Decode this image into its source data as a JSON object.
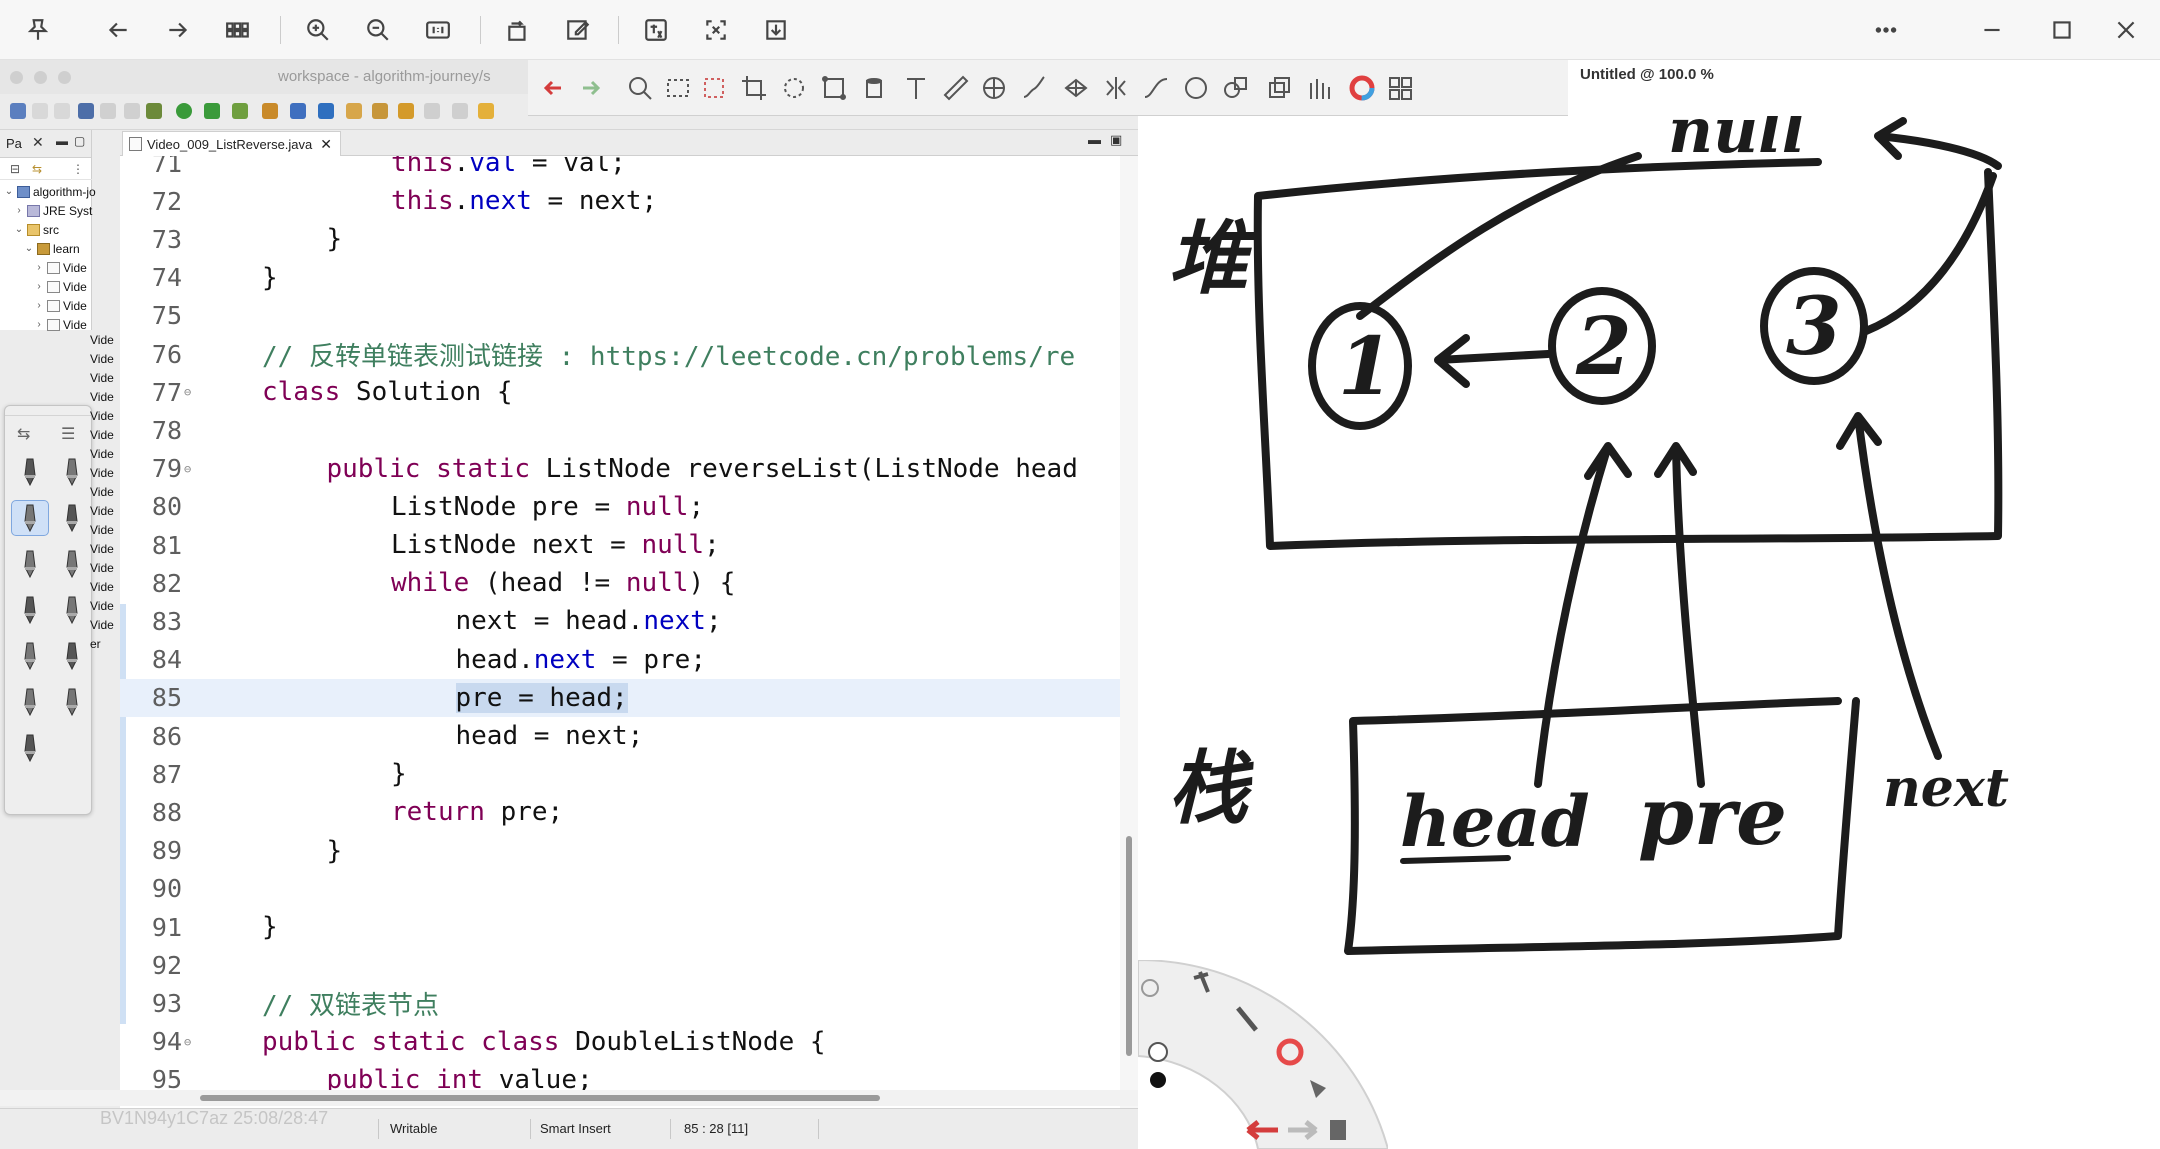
{
  "viewer": {
    "toolbar_icons": [
      "pin-icon",
      "back-icon",
      "forward-icon",
      "grid-icon",
      "zoom-in-icon",
      "zoom-out-icon",
      "actual-size-icon",
      "rotate-icon",
      "edit-icon",
      "translate-icon",
      "fit-icon",
      "download-icon"
    ],
    "more_icon": "more-icon",
    "window_controls": [
      "minimize-icon",
      "maximize-icon",
      "close-icon"
    ]
  },
  "eclipse": {
    "title": "workspace - algorithm-journey/s",
    "package_explorer": {
      "tab_label": "Pa",
      "tree": [
        {
          "label": "algorithm-jo",
          "indent": 0,
          "icon": "proj",
          "chevron": "v"
        },
        {
          "label": "JRE Syst",
          "indent": 1,
          "icon": "lib",
          "chevron": ">"
        },
        {
          "label": "src",
          "indent": 1,
          "icon": "folder",
          "chevron": "v"
        },
        {
          "label": "learn",
          "indent": 2,
          "icon": "pkg",
          "chevron": "v"
        },
        {
          "label": "Vide",
          "indent": 3,
          "icon": "file",
          "chevron": ">"
        },
        {
          "label": "Vide",
          "indent": 3,
          "icon": "file",
          "chevron": ">"
        },
        {
          "label": "Vide",
          "indent": 3,
          "icon": "file",
          "chevron": ">"
        },
        {
          "label": "Vide",
          "indent": 3,
          "icon": "file",
          "chevron": ">"
        }
      ],
      "hidden_rows": [
        "Vide",
        "Vide",
        "Vide",
        "Vide",
        "Vide",
        "Vide",
        "Vide",
        "Vide",
        "Vide",
        "Vide",
        "Vide",
        "Vide",
        "Vide",
        "Vide",
        "Vide",
        "Vide",
        "er"
      ]
    },
    "editor": {
      "tab_label": "Video_009_ListReverse.java",
      "lines": [
        {
          "n": "71",
          "code": "this.val = val;",
          "indent": 2,
          "parts": [
            {
              "t": "this",
              "c": "kw"
            },
            {
              "t": ".",
              "c": ""
            },
            {
              "t": "val",
              "c": "fld"
            },
            {
              "t": " = val;",
              "c": ""
            }
          ]
        },
        {
          "n": "72",
          "code": "this.next = next;",
          "indent": 2,
          "parts": [
            {
              "t": "this",
              "c": "kw"
            },
            {
              "t": ".",
              "c": ""
            },
            {
              "t": "next",
              "c": "fld"
            },
            {
              "t": " = next;",
              "c": ""
            }
          ]
        },
        {
          "n": "73",
          "indent": 1,
          "parts": [
            {
              "t": "}",
              "c": ""
            }
          ]
        },
        {
          "n": "74",
          "indent": 0,
          "parts": [
            {
              "t": "}",
              "c": ""
            }
          ]
        },
        {
          "n": "75",
          "indent": 0,
          "parts": []
        },
        {
          "n": "76",
          "indent": 0,
          "parts": [
            {
              "t": "// 反转单链表测试链接 : https://leetcode.cn/problems/re",
              "c": "cm"
            }
          ]
        },
        {
          "n": "77",
          "indent": 0,
          "fold": true,
          "parts": [
            {
              "t": "class",
              "c": "kw"
            },
            {
              "t": " Solution {",
              "c": ""
            }
          ]
        },
        {
          "n": "78",
          "indent": 0,
          "parts": []
        },
        {
          "n": "79",
          "indent": 1,
          "fold": true,
          "parts": [
            {
              "t": "public static",
              "c": "kw"
            },
            {
              "t": " ListNode reverseList(ListNode head",
              "c": ""
            }
          ]
        },
        {
          "n": "80",
          "indent": 2,
          "parts": [
            {
              "t": "ListNode pre = ",
              "c": ""
            },
            {
              "t": "null",
              "c": "kw"
            },
            {
              "t": ";",
              "c": ""
            }
          ]
        },
        {
          "n": "81",
          "indent": 2,
          "parts": [
            {
              "t": "ListNode next = ",
              "c": ""
            },
            {
              "t": "null",
              "c": "kw"
            },
            {
              "t": ";",
              "c": ""
            }
          ]
        },
        {
          "n": "82",
          "indent": 2,
          "parts": [
            {
              "t": "while",
              "c": "kw"
            },
            {
              "t": " (head != ",
              "c": ""
            },
            {
              "t": "null",
              "c": "kw"
            },
            {
              "t": ") {",
              "c": ""
            }
          ]
        },
        {
          "n": "83",
          "indent": 3,
          "parts": [
            {
              "t": "next = head.",
              "c": ""
            },
            {
              "t": "next",
              "c": "fld"
            },
            {
              "t": ";",
              "c": ""
            }
          ]
        },
        {
          "n": "84",
          "indent": 3,
          "parts": [
            {
              "t": "head.",
              "c": ""
            },
            {
              "t": "next",
              "c": "fld"
            },
            {
              "t": " = pre;",
              "c": ""
            }
          ]
        },
        {
          "n": "85",
          "indent": 3,
          "current": true,
          "parts": [
            {
              "t": "pre = head;",
              "c": "sel"
            }
          ]
        },
        {
          "n": "86",
          "indent": 3,
          "parts": [
            {
              "t": "head = next;",
              "c": ""
            }
          ]
        },
        {
          "n": "87",
          "indent": 2,
          "parts": [
            {
              "t": "}",
              "c": ""
            }
          ]
        },
        {
          "n": "88",
          "indent": 2,
          "parts": [
            {
              "t": "return",
              "c": "kw"
            },
            {
              "t": " pre;",
              "c": ""
            }
          ]
        },
        {
          "n": "89",
          "indent": 1,
          "parts": [
            {
              "t": "}",
              "c": ""
            }
          ]
        },
        {
          "n": "90",
          "indent": 0,
          "parts": []
        },
        {
          "n": "91",
          "indent": 0,
          "parts": [
            {
              "t": "}",
              "c": ""
            }
          ]
        },
        {
          "n": "92",
          "indent": 0,
          "parts": []
        },
        {
          "n": "93",
          "indent": 0,
          "parts": [
            {
              "t": "// 双链表节点",
              "c": "cm"
            }
          ]
        },
        {
          "n": "94",
          "indent": 0,
          "fold": true,
          "parts": [
            {
              "t": "public static class",
              "c": "kw"
            },
            {
              "t": " DoubleListNode {",
              "c": ""
            }
          ]
        },
        {
          "n": "95",
          "indent": 1,
          "parts": [
            {
              "t": "public int",
              "c": "kw"
            },
            {
              "t": " value;",
              "c": ""
            }
          ]
        }
      ]
    },
    "status": {
      "writable": "Writable",
      "insert_mode": "Smart Insert",
      "position": "85 : 28 [11]"
    },
    "watermark": "BV1N94y1C7az 25:08/28:47"
  },
  "canvas": {
    "title": "Untitled @ 100.0 %",
    "handwriting": {
      "null": "null",
      "heap": "堆",
      "stack": "栈",
      "node1": "1",
      "node2": "2",
      "node3": "3",
      "head": "head",
      "pre": "pre",
      "next": "next"
    },
    "toolbar_icons": [
      "undo-icon",
      "redo-icon",
      "magnifier-icon",
      "marquee-icon",
      "lasso-icon",
      "crop-icon",
      "select-icon",
      "transform-icon",
      "bucket-icon",
      "text-icon",
      "ruler-icon",
      "symmetry-icon",
      "brush-icon",
      "grid-icon",
      "mirror-icon",
      "curve-icon",
      "ellipse-icon",
      "shapes-icon",
      "layers-icon",
      "tools-icon",
      "color-wheel-icon",
      "panels-icon"
    ]
  },
  "colors": {
    "keyword": "#7f0055",
    "field": "#0000c0",
    "comment": "#3f7f5f",
    "current_line": "#e8f0fb",
    "selection": "#c8d9ef",
    "ink": "#1a1a1a"
  }
}
